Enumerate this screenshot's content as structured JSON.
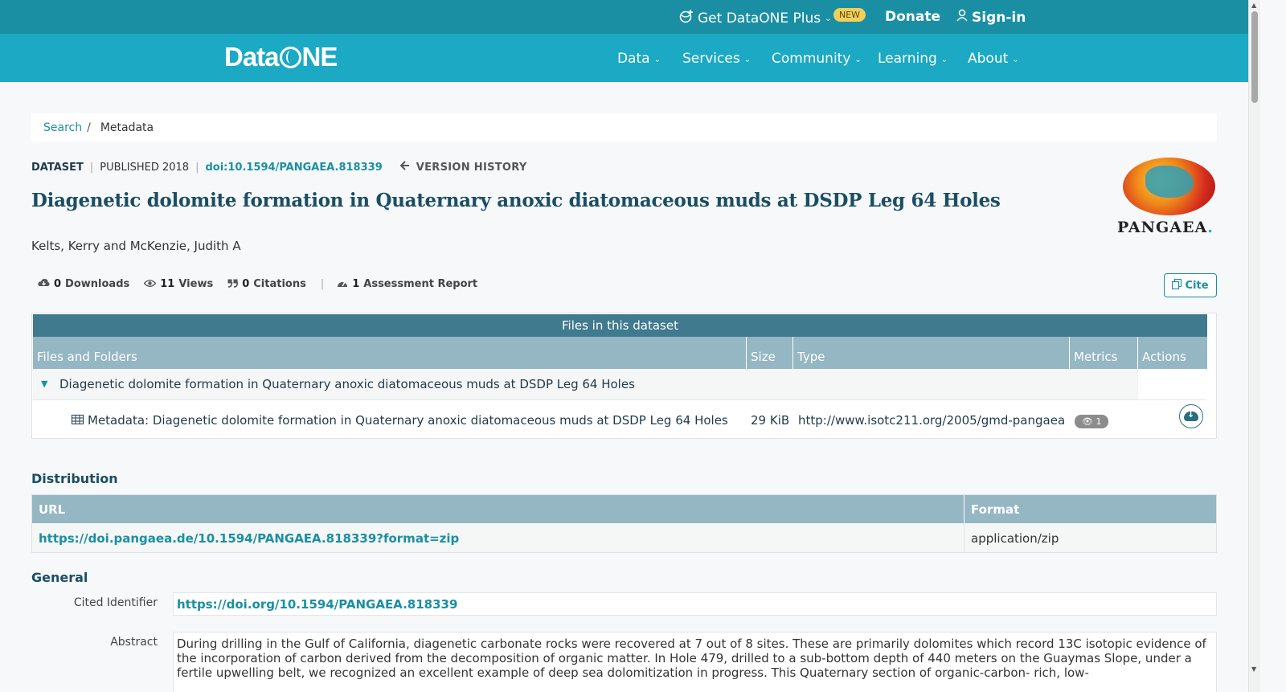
{
  "topbar": {
    "plus_label": "Get DataONE Plus",
    "new_badge": "NEW",
    "donate": "Donate",
    "signin": "Sign-in"
  },
  "nav": {
    "logo": {
      "left": "Data",
      "right": "NE"
    },
    "items": [
      "Data",
      "Services",
      "Community",
      "Learning",
      "About"
    ]
  },
  "breadcrumb": {
    "search": "Search",
    "separator": "/",
    "current": "Metadata"
  },
  "meta": {
    "type": "DATASET",
    "published": "PUBLISHED 2018",
    "doi": "doi:10.1594/PANGAEA.818339",
    "version_history": "VERSION HISTORY"
  },
  "title": "Diagenetic dolomite formation in Quaternary anoxic diatomaceous muds at DSDP Leg 64 Holes",
  "authors": "Kelts, Kerry and McKenzie, Judith A",
  "repository_logo": {
    "word": "PANGAEA",
    "dot": "."
  },
  "stats": {
    "downloads": {
      "count": "0",
      "label": "Downloads"
    },
    "views": {
      "count": "11",
      "label": "Views"
    },
    "citations": {
      "count": "0",
      "label": "Citations"
    },
    "assessment": {
      "count": "1",
      "label": "Assessment Report"
    }
  },
  "cite_button": "Cite",
  "files": {
    "caption": "Files in this dataset",
    "headers": [
      "Files and Folders",
      "Size",
      "Type",
      "Metrics",
      "Actions"
    ],
    "folder": "Diagenetic dolomite formation in Quaternary anoxic diatomaceous muds at DSDP Leg 64 Holes",
    "file": {
      "name": "Metadata: Diagenetic dolomite formation in Quaternary anoxic diatomaceous muds at DSDP Leg 64 Holes",
      "size": "29 KiB",
      "type": "http://www.isotc211.org/2005/gmd-pangaea",
      "views": "1"
    }
  },
  "distribution": {
    "heading": "Distribution",
    "headers": [
      "URL",
      "Format"
    ],
    "url": "https://doi.pangaea.de/10.1594/PANGAEA.818339?format=zip",
    "format": "application/zip"
  },
  "general": {
    "heading": "General",
    "cited_identifier_label": "Cited Identifier",
    "cited_identifier": "https://doi.org/10.1594/PANGAEA.818339",
    "abstract_label": "Abstract",
    "abstract": "During drilling in the Gulf of California, diagenetic carbonate rocks were recovered at 7 out of 8 sites. These are primarily dolomites which record 13C isotopic evidence of the incorporation of carbon derived from the decomposition of organic matter. In Hole 479, drilled to a sub-bottom depth of 440 meters on the Guaymas Slope, under a fertile upwelling belt, we recognized an excellent example of deep sea dolomitization in progress. This Quaternary section of organic-carbon- rich, low-"
  },
  "colors": {
    "topbar": "#1a8fa4",
    "navbar": "#1ba9c3",
    "title": "#1b4e63",
    "table_caption": "#3f7a8e",
    "table_header": "#95b6c3",
    "link": "#1a8fa4",
    "badge_new": "#f3cf5a"
  }
}
